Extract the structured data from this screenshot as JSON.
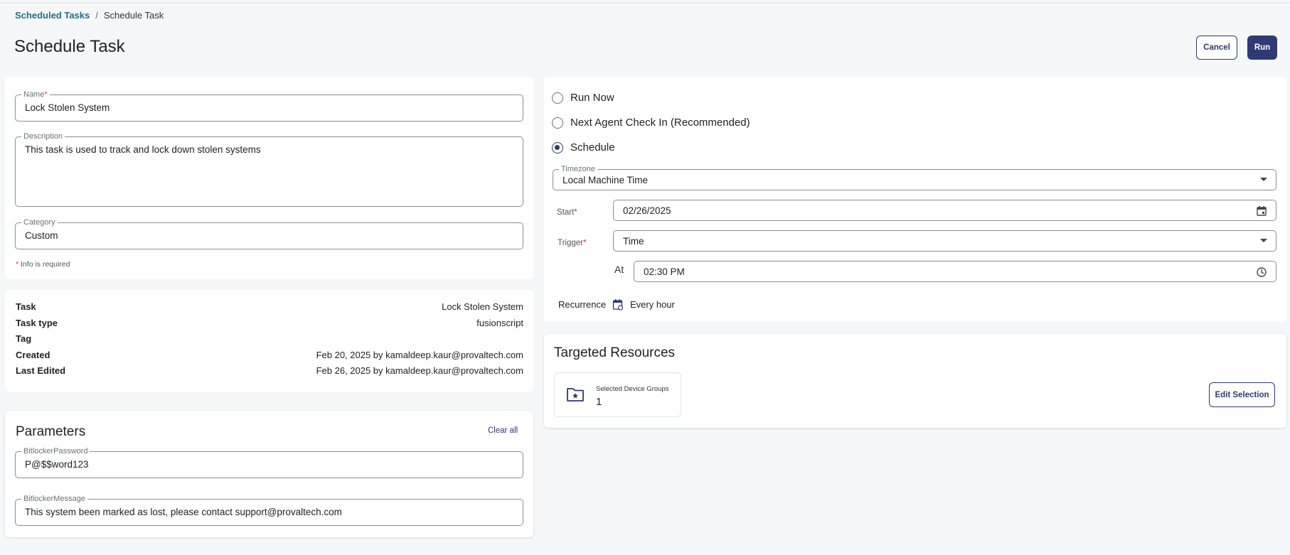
{
  "breadcrumb": {
    "parent": "Scheduled Tasks",
    "separator": "/",
    "current": "Schedule Task"
  },
  "page": {
    "title": "Schedule Task"
  },
  "actions": {
    "cancel_label": "Cancel",
    "run_label": "Run"
  },
  "form": {
    "name_label": "Name",
    "name_value": "Lock Stolen System",
    "description_label": "Description",
    "description_value": "This task is used to track and lock down stolen systems",
    "category_label": "Category",
    "category_value": "Custom",
    "required_marker": "*",
    "required_note": "Info is required"
  },
  "info": {
    "task_key": "Task",
    "task_value": "Lock Stolen System",
    "type_key": "Task type",
    "type_value": "fusionscript",
    "tag_key": "Tag",
    "tag_value": "",
    "created_key": "Created",
    "created_value": "Feb 20, 2025 by kamaldeep.kaur@provaltech.com",
    "edited_key": "Last Edited",
    "edited_value": "Feb 26, 2025 by kamaldeep.kaur@provaltech.com"
  },
  "parameters": {
    "title": "Parameters",
    "clear_label": "Clear all",
    "p1_label": "BitlockerPassword",
    "p1_value": "P@$$word123",
    "p2_label": "BitlockerMessage",
    "p2_value": "This system been marked as lost, please contact support@provaltech.com"
  },
  "schedule": {
    "options": [
      "Run Now",
      "Next Agent Check In (Recommended)",
      "Schedule"
    ],
    "selected": "Schedule",
    "timezone_label": "Timezone",
    "timezone_value": "Local Machine Time",
    "start_label": "Start",
    "start_value": "02/26/2025",
    "trigger_label": "Trigger",
    "trigger_value": "Time",
    "at_label": "At",
    "at_value": "02:30 PM",
    "recurrence_label": "Recurrence",
    "recurrence_value": "Every hour"
  },
  "targets": {
    "title": "Targeted Resources",
    "tile_label": "Selected Device Groups",
    "tile_value": "1",
    "edit_label": "Edit Selection"
  },
  "colors": {
    "accent": "#2e3a73",
    "link": "#1d6f86",
    "required": "#c0392b"
  },
  "icons": [
    "calendar-icon",
    "clock-icon",
    "recurrence-calendar-icon",
    "folder-star-icon",
    "chevron-down-icon"
  ]
}
